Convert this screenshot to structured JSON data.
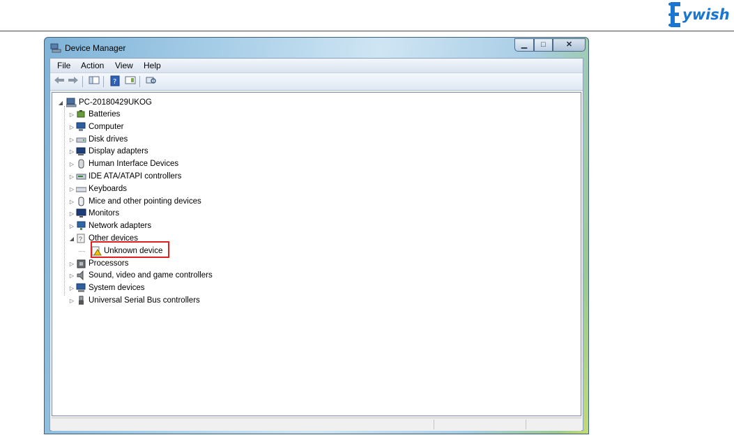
{
  "brand": {
    "logo_text": "ywish",
    "accent": "#1976d2"
  },
  "window": {
    "title": "Device Manager",
    "controls": {
      "minimize": "▁",
      "maximize": "□",
      "close": "✕"
    }
  },
  "menu": [
    "File",
    "Action",
    "View",
    "Help"
  ],
  "toolbar": {
    "buttons": [
      "back-icon",
      "forward-icon",
      "show-hide-console-tree-icon",
      "help-icon",
      "properties-icon",
      "scan-hardware-icon"
    ]
  },
  "tree": {
    "root": {
      "label": "PC-20180429UKOG",
      "expanded": true
    },
    "categories": [
      {
        "label": "Batteries",
        "expanded": false
      },
      {
        "label": "Computer",
        "expanded": false
      },
      {
        "label": "Disk drives",
        "expanded": false
      },
      {
        "label": "Display adapters",
        "expanded": false
      },
      {
        "label": "Human Interface Devices",
        "expanded": false
      },
      {
        "label": "IDE ATA/ATAPI controllers",
        "expanded": false
      },
      {
        "label": "Keyboards",
        "expanded": false
      },
      {
        "label": "Mice and other pointing devices",
        "expanded": false
      },
      {
        "label": "Monitors",
        "expanded": false
      },
      {
        "label": "Network adapters",
        "expanded": false
      },
      {
        "label": "Other devices",
        "expanded": true
      },
      {
        "label": "Unknown device",
        "child": true,
        "warning": true
      },
      {
        "label": "Processors",
        "expanded": false
      },
      {
        "label": "Sound, video and game controllers",
        "expanded": false
      },
      {
        "label": "System devices",
        "expanded": false
      },
      {
        "label": "Universal Serial Bus controllers",
        "expanded": false
      }
    ]
  },
  "status": {
    "colors": {
      "highlight": "#e02020",
      "warning": "#f2c200"
    }
  }
}
